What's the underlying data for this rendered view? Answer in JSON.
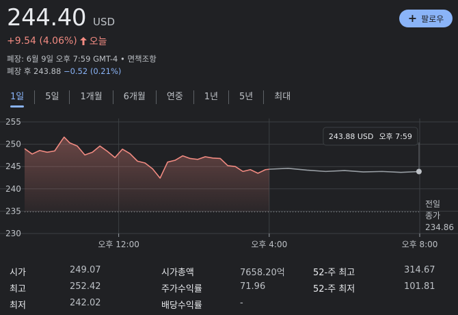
{
  "quote": {
    "price": "244.40",
    "currency": "USD",
    "change": "+9.54 (4.06%)",
    "period": "오늘",
    "close_info": "폐장: 6월 9일 오후 7:59 GMT-4 • 면책조항",
    "after_hours_label": "폐장 후 243.88",
    "after_hours_change": "−0.52 (0.21%)",
    "follow_label": "팔로우"
  },
  "tabs": [
    {
      "label": "1일",
      "active": true
    },
    {
      "label": "5일",
      "active": false
    },
    {
      "label": "1개월",
      "active": false
    },
    {
      "label": "6개월",
      "active": false
    },
    {
      "label": "연중",
      "active": false
    },
    {
      "label": "1년",
      "active": false
    },
    {
      "label": "5년",
      "active": false
    },
    {
      "label": "최대",
      "active": false
    }
  ],
  "chart_data": {
    "type": "line",
    "ylim": [
      230,
      255
    ],
    "y_ticks": [
      255,
      250,
      245,
      240,
      235,
      230
    ],
    "x_ticks": [
      {
        "label": "오후 12:00",
        "hour": 12
      },
      {
        "label": "오후 4:00",
        "hour": 16
      },
      {
        "label": "오후 8:00",
        "hour": 20
      }
    ],
    "x_range_hours": [
      9.5,
      20
    ],
    "previous_close": 234.86,
    "previous_close_label": [
      "전일",
      "종가",
      "234.86"
    ],
    "tooltip": {
      "price": "243.88 USD",
      "time": "오후 7:59"
    },
    "colors": {
      "regular": "#f28b82",
      "after_hours": "#9aa0a6"
    },
    "regular_session": {
      "hours": [
        9.5,
        9.7,
        9.9,
        10.1,
        10.3,
        10.5,
        10.55,
        10.7,
        10.9,
        11.1,
        11.3,
        11.5,
        11.7,
        11.9,
        12.1,
        12.3,
        12.5,
        12.7,
        12.9,
        13.1,
        13.3,
        13.5,
        13.7,
        13.9,
        14.1,
        14.3,
        14.5,
        14.7,
        14.9,
        15.1,
        15.3,
        15.5,
        15.7,
        15.9,
        16.0
      ],
      "values": [
        249,
        247.8,
        248.6,
        248.2,
        248.5,
        251,
        251.6,
        250.3,
        249.6,
        247.6,
        248.2,
        249.6,
        248.4,
        247,
        248.9,
        247.9,
        246.2,
        245.8,
        244.5,
        242.4,
        246,
        246.4,
        247.4,
        246.8,
        246.6,
        247.2,
        246.9,
        246.8,
        245.2,
        245,
        243.9,
        244.3,
        243.5,
        244.3,
        244.4
      ]
    },
    "after_hours_session": {
      "hours": [
        16.0,
        16.5,
        17,
        17.5,
        18,
        18.5,
        19,
        19.5,
        19.98
      ],
      "values": [
        244.4,
        244.6,
        244.2,
        243.9,
        244.1,
        243.8,
        243.9,
        243.7,
        243.88
      ]
    }
  },
  "stats": [
    {
      "label": "시가",
      "value": "249.07"
    },
    {
      "label": "최고",
      "value": "252.42"
    },
    {
      "label": "최저",
      "value": "242.02"
    },
    {
      "label": "시가총액",
      "value": "7658.20억"
    },
    {
      "label": "주가수익률",
      "value": "71.96"
    },
    {
      "label": "배당수익률",
      "value": "-"
    },
    {
      "label": "52-주 최고",
      "value": "314.67"
    },
    {
      "label": "52-주 최저",
      "value": "101.81"
    }
  ]
}
